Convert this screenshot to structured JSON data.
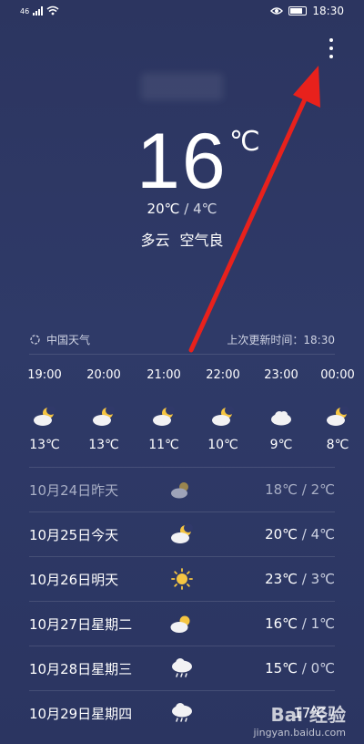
{
  "status": {
    "signal_text": "46",
    "time": "18:30"
  },
  "current": {
    "temp": "16",
    "unit": "℃",
    "high": "20℃",
    "low": "4℃",
    "condition": "多云",
    "air": "空气良"
  },
  "source": {
    "name": "中国天气",
    "updated_label": "上次更新时间：18:30"
  },
  "hourly": [
    {
      "time": "19:00",
      "icon": "moon-cloud-icon",
      "temp": "13℃"
    },
    {
      "time": "20:00",
      "icon": "moon-cloud-icon",
      "temp": "13℃"
    },
    {
      "time": "21:00",
      "icon": "moon-cloud-icon",
      "temp": "11℃"
    },
    {
      "time": "22:00",
      "icon": "moon-cloud-icon",
      "temp": "10℃"
    },
    {
      "time": "23:00",
      "icon": "cloud-icon",
      "temp": "9℃"
    },
    {
      "time": "00:00",
      "icon": "moon-cloud-icon",
      "temp": "8℃"
    }
  ],
  "daily": [
    {
      "date": "10月24日昨天",
      "icon": "sun-cloud-icon",
      "high": "18℃",
      "low": "2℃"
    },
    {
      "date": "10月25日今天",
      "icon": "moon-cloud-icon",
      "high": "20℃",
      "low": "4℃"
    },
    {
      "date": "10月26日明天",
      "icon": "sun-icon",
      "high": "23℃",
      "low": "3℃"
    },
    {
      "date": "10月27日星期二",
      "icon": "sun-cloud-icon",
      "high": "16℃",
      "low": "1℃"
    },
    {
      "date": "10月28日星期三",
      "icon": "rain-cloud-icon",
      "high": "15℃",
      "low": "0℃"
    },
    {
      "date": "10月29日星期四",
      "icon": "rain-cloud-icon",
      "high": "17℃",
      "low": ""
    }
  ],
  "watermark": {
    "brand": "Bai 经验",
    "url": "jingyan.baidu.com"
  },
  "colors": {
    "annotation_arrow": "#e8211c",
    "background": "#2c3560"
  }
}
